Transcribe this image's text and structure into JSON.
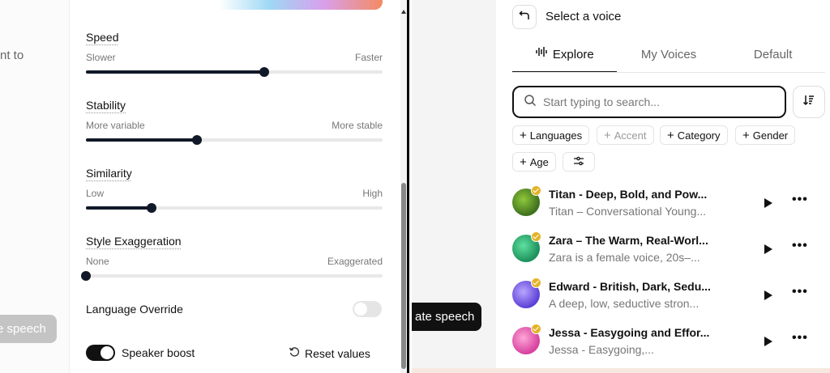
{
  "left": {
    "cut_text": "nt to",
    "cut_button": "e speech",
    "sliders": [
      {
        "title": "Speed",
        "min_label": "Slower",
        "max_label": "Faster",
        "value": 0.6
      },
      {
        "title": "Stability",
        "min_label": "More variable",
        "max_label": "More stable",
        "value": 0.375
      },
      {
        "title": "Similarity",
        "min_label": "Low",
        "max_label": "High",
        "value": 0.22
      },
      {
        "title": "Style Exaggeration",
        "min_label": "None",
        "max_label": "Exaggerated",
        "value": 0.0
      }
    ],
    "language_override": {
      "label": "Language Override",
      "enabled": false
    },
    "speaker_boost": {
      "label": "Speaker boost",
      "enabled": true
    },
    "reset_label": "Reset values"
  },
  "right": {
    "generate_button": "ate speech",
    "title": "Select a voice",
    "tabs": [
      {
        "label": "Explore",
        "active": true
      },
      {
        "label": "My Voices",
        "active": false
      },
      {
        "label": "Default",
        "active": false
      }
    ],
    "search": {
      "placeholder": "Start typing to search...",
      "value": ""
    },
    "filters": [
      {
        "label": "Languages",
        "enabled": true
      },
      {
        "label": "Accent",
        "enabled": false
      },
      {
        "label": "Category",
        "enabled": true
      },
      {
        "label": "Gender",
        "enabled": true
      },
      {
        "label": "Age",
        "enabled": true
      }
    ],
    "voices": [
      {
        "name": "Titan - Deep, Bold, and Pow...",
        "desc": "Titan – Conversational Young...",
        "color_a": "#8fc93a",
        "color_b": "#3d6e1e"
      },
      {
        "name": "Zara – The Warm, Real-Worl...",
        "desc": "Zara is a female voice, 20s–...",
        "color_a": "#5fe0a0",
        "color_b": "#1c8f5a"
      },
      {
        "name": "Edward - British, Dark, Sedu...",
        "desc": "A deep, low, seductive stron...",
        "color_a": "#b9a6ff",
        "color_b": "#5b3fd6"
      },
      {
        "name": "Jessa - Easygoing and Effor...",
        "desc": "Jessa - Easygoing,...",
        "color_a": "#ffa6d8",
        "color_b": "#d63f9e"
      }
    ]
  }
}
